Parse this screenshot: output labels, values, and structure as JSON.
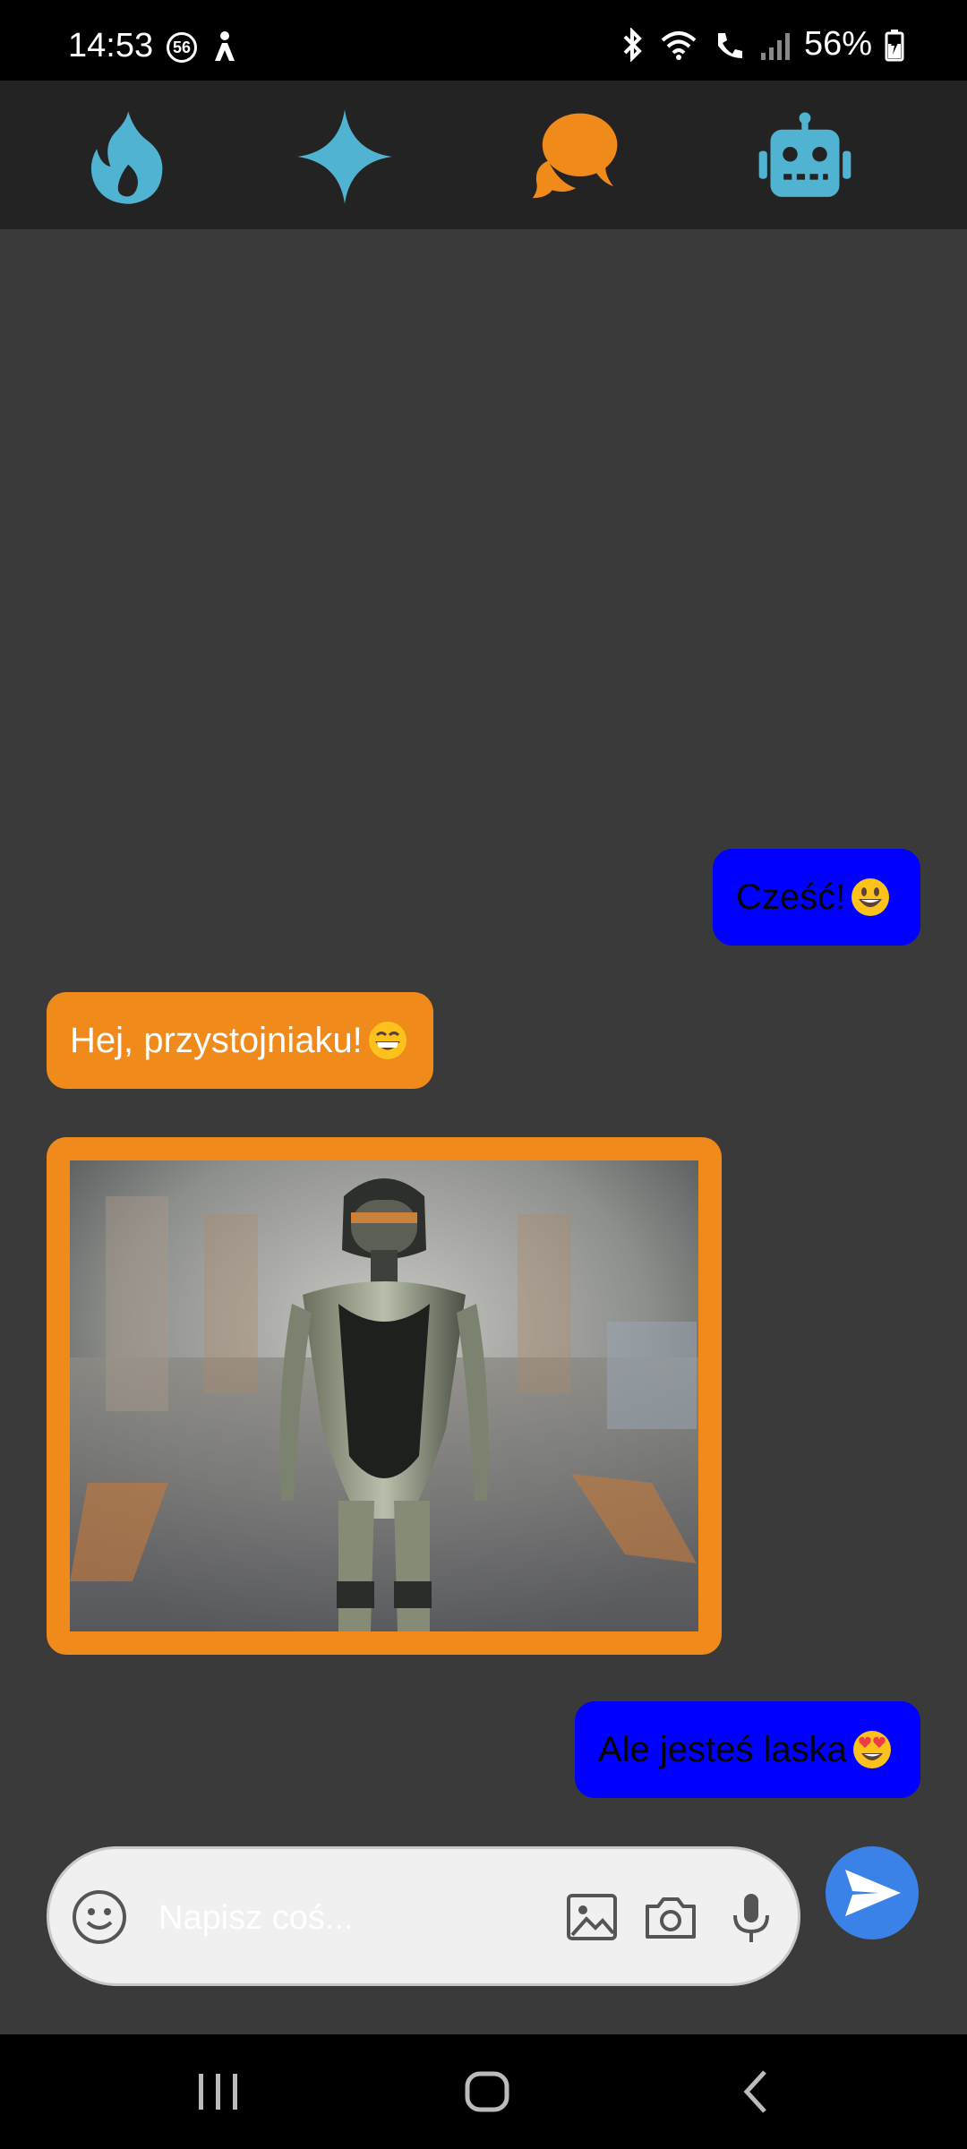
{
  "status_bar": {
    "time": "14:53",
    "notification_badge": "56",
    "battery": "56%"
  },
  "nav": {
    "icons": [
      "flame-icon",
      "sparkle-icon",
      "chat-bubbles-icon",
      "robot-icon"
    ],
    "inactive_color": "#4fb3d1",
    "active_color": "#ef8a1b"
  },
  "messages": [
    {
      "sender": "user",
      "text": "Cześć!",
      "emoji": "grinning-face"
    },
    {
      "sender": "bot",
      "text": "Hej, przystojniaku!",
      "emoji": "beaming-face"
    },
    {
      "sender": "bot",
      "type": "image",
      "image": "android-woman-figure"
    },
    {
      "sender": "user",
      "text": "Ale jesteś laska",
      "emoji": "heart-eyes-face"
    }
  ],
  "colors": {
    "user_bubble": "#0000ff",
    "bot_bubble": "#ef8a1b",
    "send_button": "#3b82e8",
    "background": "#3a3a3a"
  },
  "composer": {
    "placeholder": "Napisz coś...",
    "icons": [
      "emoji-icon",
      "gallery-icon",
      "camera-icon",
      "microphone-icon",
      "send-icon"
    ]
  },
  "system_nav": {
    "icons": [
      "recent-apps-icon",
      "home-icon",
      "back-icon"
    ]
  }
}
